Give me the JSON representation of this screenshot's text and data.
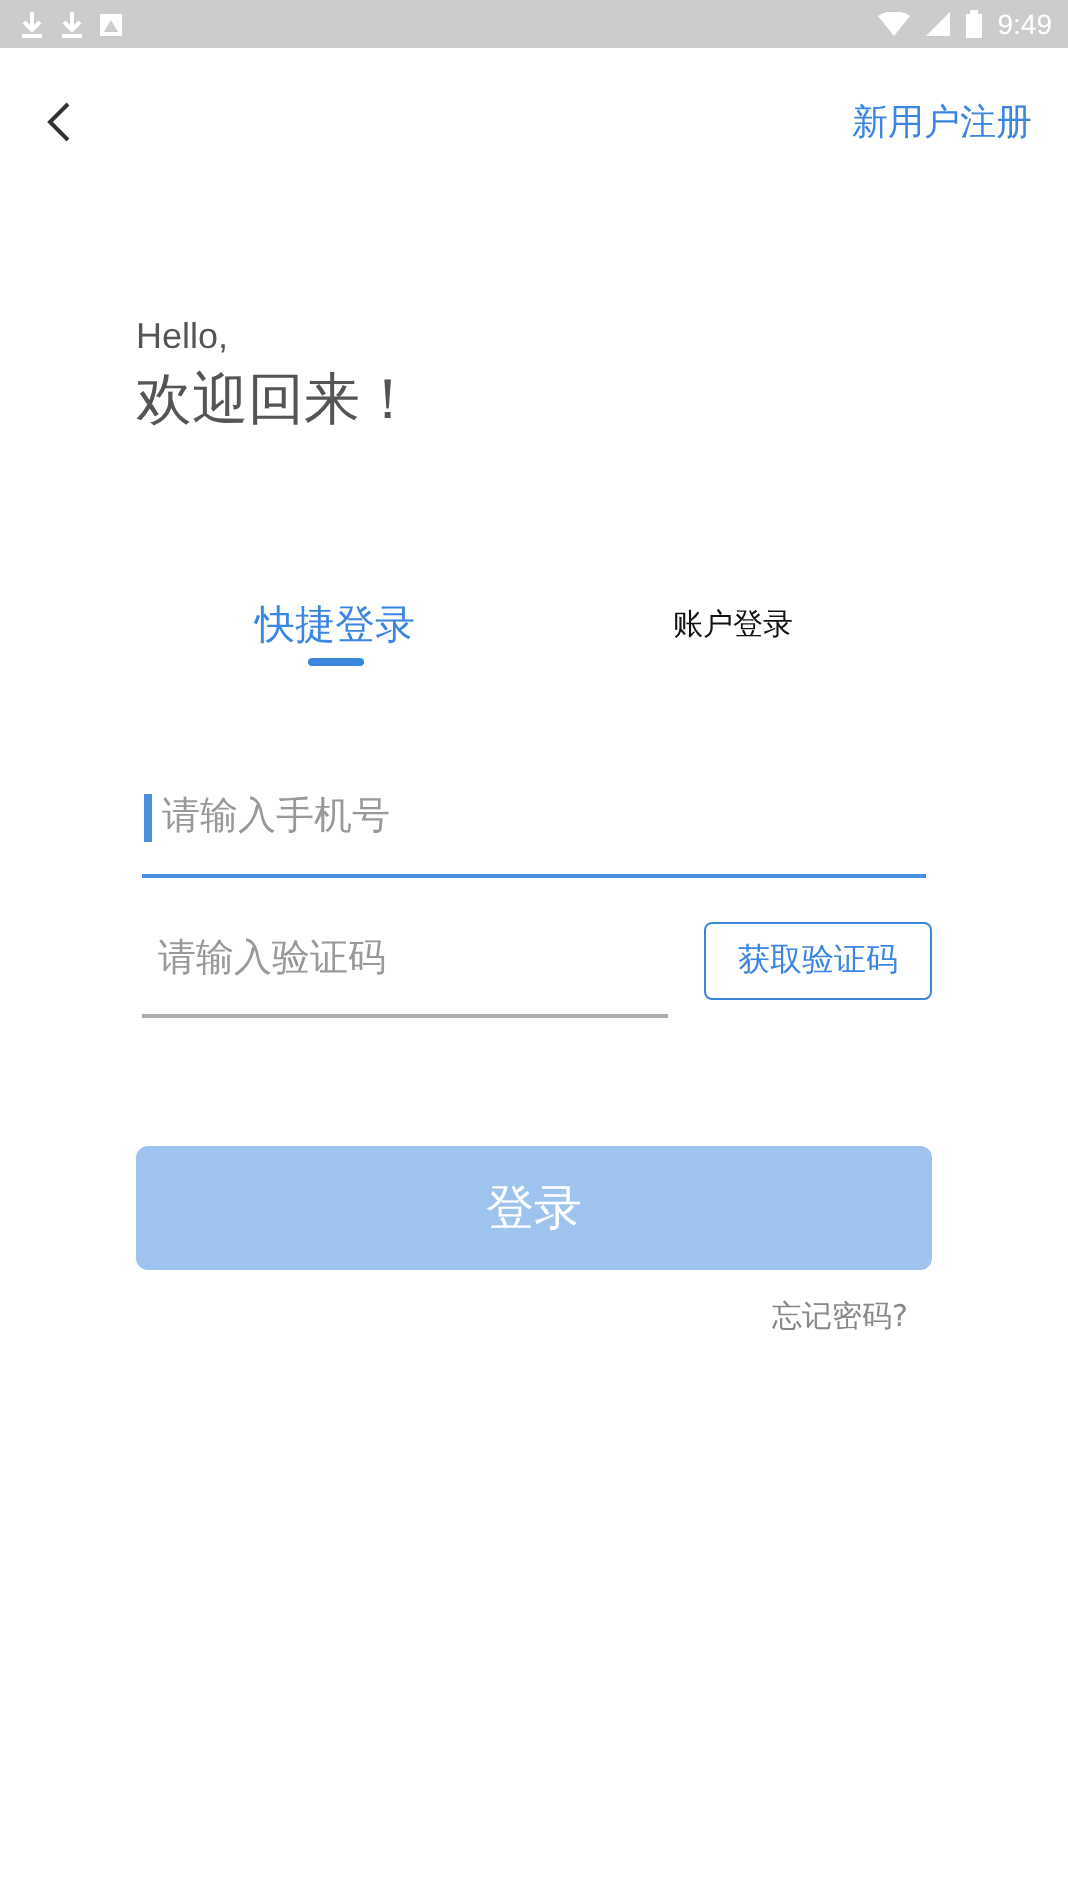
{
  "status_bar": {
    "time": "9:49"
  },
  "header": {
    "register_link": "新用户注册"
  },
  "greeting": {
    "hello": "Hello,",
    "welcome": "欢迎回来！"
  },
  "tabs": [
    {
      "label": "快捷登录",
      "selected": true
    },
    {
      "label": "账户登录",
      "selected": false
    }
  ],
  "phone_field": {
    "placeholder": "请输入手机号",
    "focused": true
  },
  "code_field": {
    "placeholder": "请输入验证码"
  },
  "code_button": "获取验证码",
  "login_button": {
    "label": "登录",
    "disabled": true
  },
  "forgot_link": "忘记密码?"
}
